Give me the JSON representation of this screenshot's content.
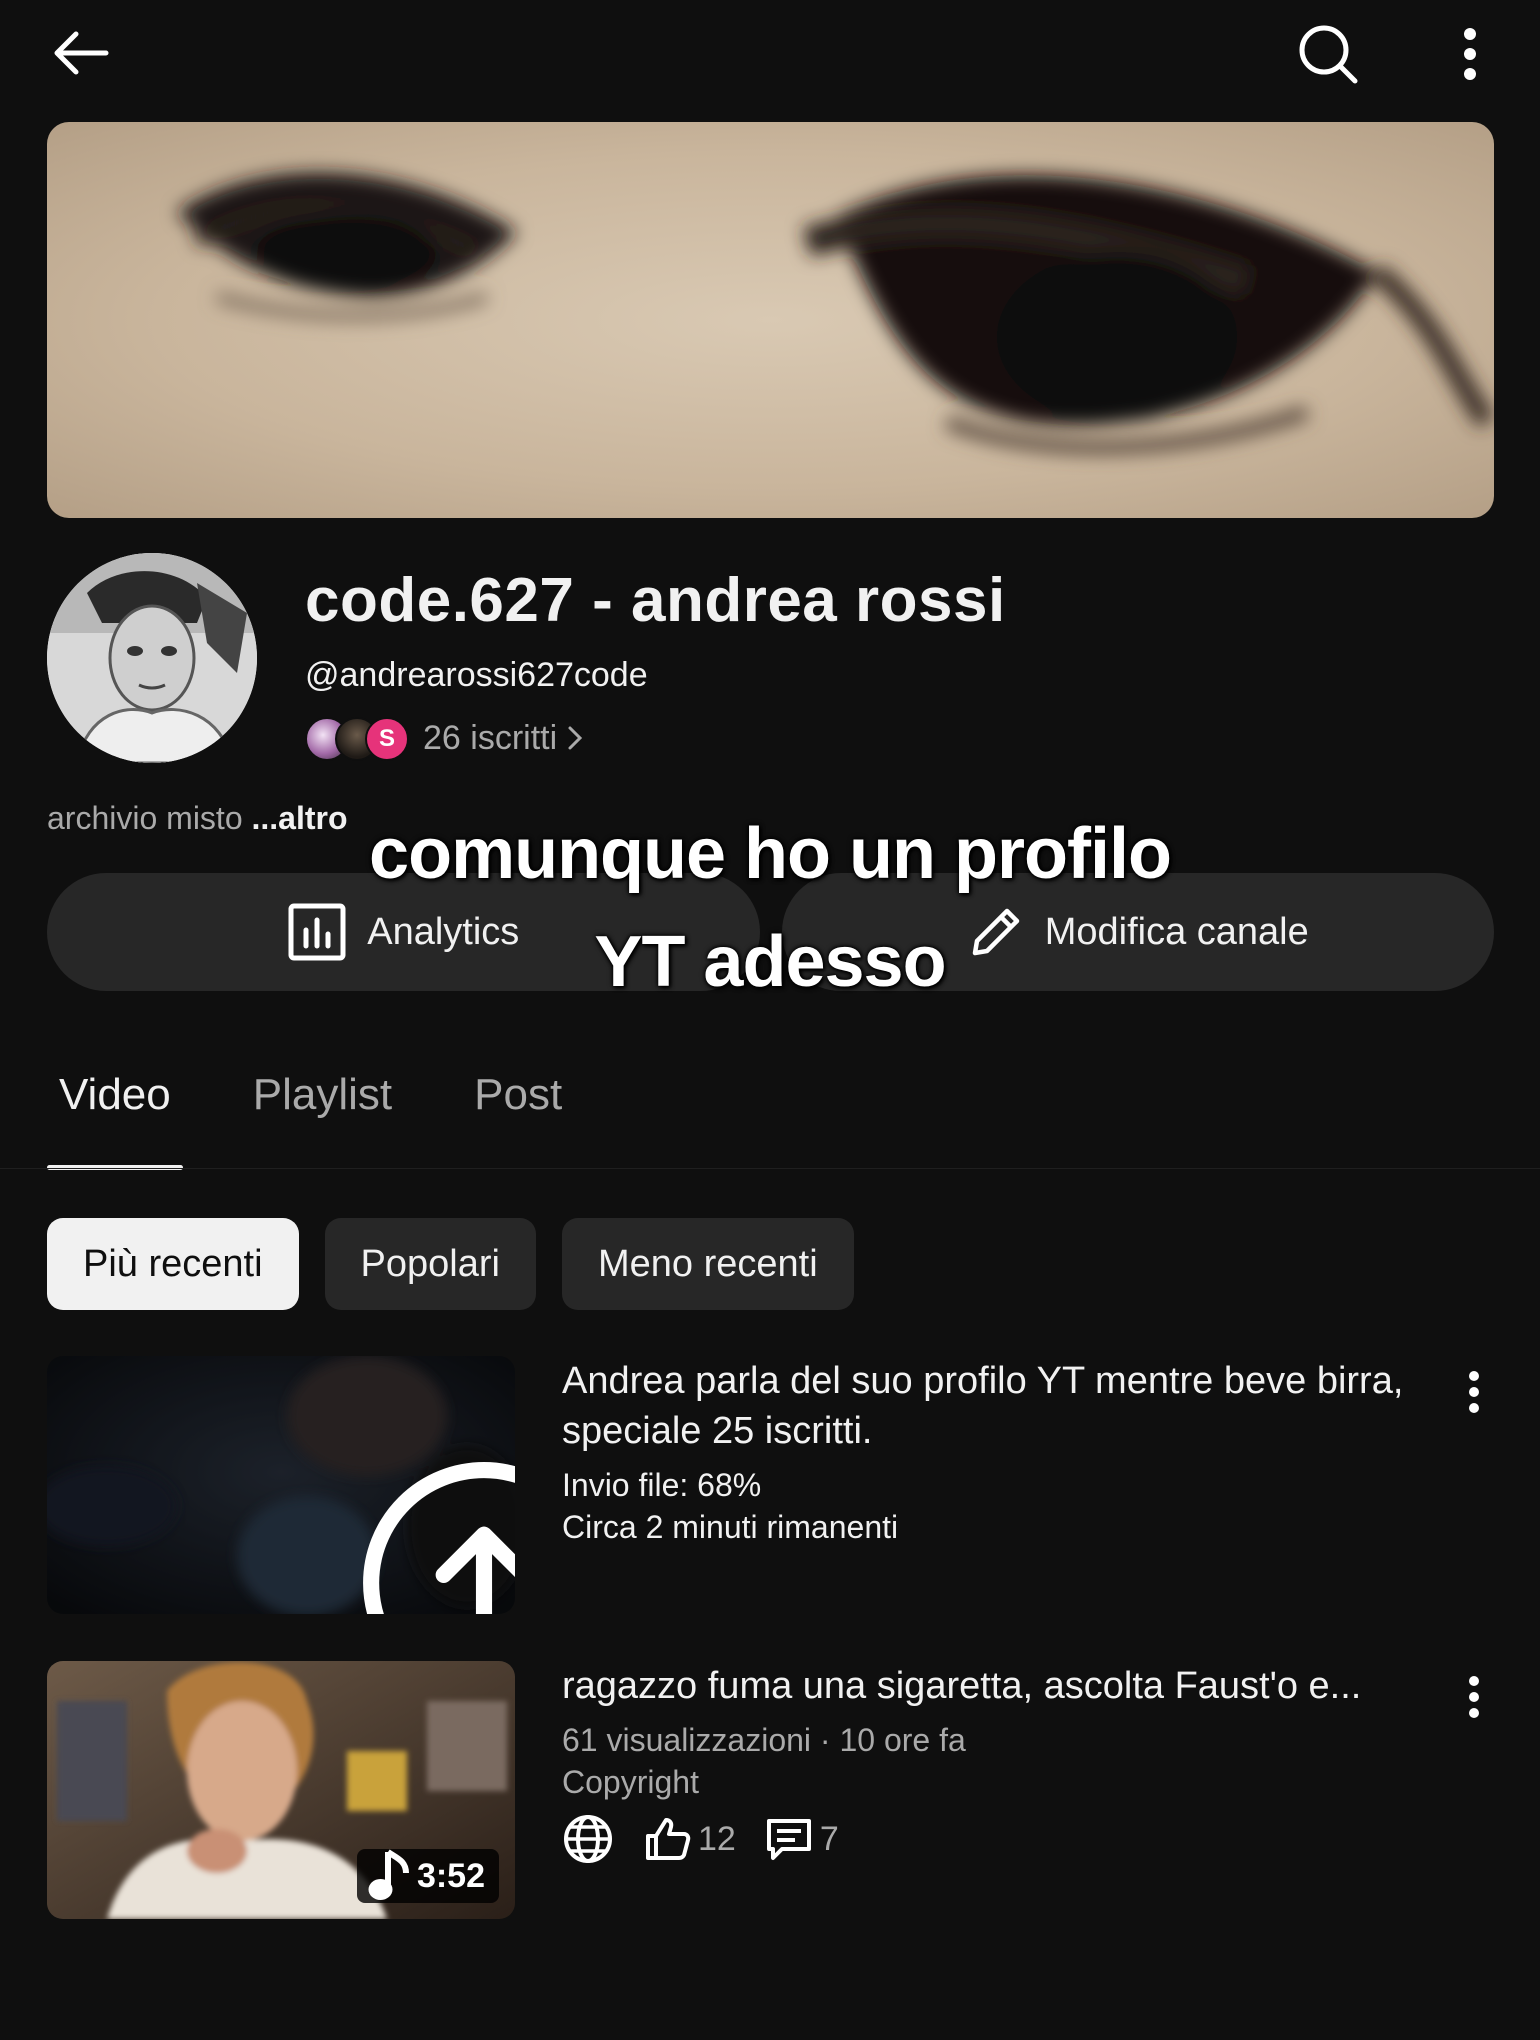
{
  "topbar": {
    "back_icon": "arrow-left-icon",
    "search_icon": "search-icon",
    "more_icon": "more-vert-icon"
  },
  "channel": {
    "name": "code.627 - andrea rossi",
    "handle": "@andrearossi627code",
    "subscribers": "26 iscritti",
    "subscriber_avatar_letter": "S",
    "description": "archivio misto ",
    "description_more": "...altro"
  },
  "actions": {
    "analytics_label": "Analytics",
    "edit_label": "Modifica canale"
  },
  "caption": {
    "line1": "comunque ho un profilo",
    "line2": "YT adesso"
  },
  "tabs": [
    {
      "label": "Video",
      "active": true
    },
    {
      "label": "Playlist",
      "active": false
    },
    {
      "label": "Post",
      "active": false
    }
  ],
  "chips": [
    {
      "label": "Più recenti",
      "active": true
    },
    {
      "label": "Popolari",
      "active": false
    },
    {
      "label": "Meno recenti",
      "active": false
    }
  ],
  "videos": [
    {
      "title": "Andrea parla del suo profilo YT mentre beve birra, speciale 25 iscritti.",
      "upload_status": "Invio file: 68%",
      "upload_progress": 0.68,
      "time_left": "Circa 2 minuti rimanenti"
    },
    {
      "title": "ragazzo fuma una sigaretta, ascolta Faust'o e...",
      "meta": "61 visualizzazioni · 10 ore fa",
      "copyright": "Copyright",
      "duration": "3:52",
      "likes": "12",
      "comments": "7"
    }
  ],
  "colors": {
    "background": "#0f0f0f",
    "surface": "#272727",
    "text": "#f1f1f1",
    "secondary_text": "#aaaaaa",
    "subscriber_badge": "#e6337a"
  }
}
